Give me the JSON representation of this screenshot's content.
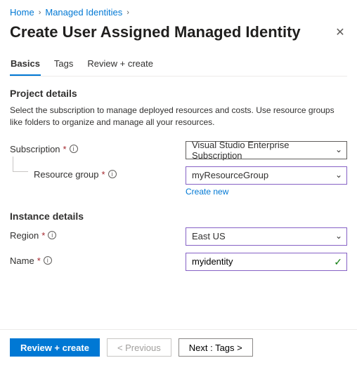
{
  "breadcrumb": {
    "items": [
      "Home",
      "Managed Identities"
    ]
  },
  "title": "Create User Assigned Managed Identity",
  "tabs": {
    "basics": "Basics",
    "tags": "Tags",
    "review": "Review + create"
  },
  "project": {
    "heading": "Project details",
    "description": "Select the subscription to manage deployed resources and costs. Use resource groups like folders to organize and manage all your resources.",
    "subscription_label": "Subscription",
    "subscription_value": "Visual Studio Enterprise Subscription",
    "rg_label": "Resource group",
    "rg_value": "myResourceGroup",
    "create_new": "Create new"
  },
  "instance": {
    "heading": "Instance details",
    "region_label": "Region",
    "region_value": "East US",
    "name_label": "Name",
    "name_value": "myidentity"
  },
  "footer": {
    "review": "Review + create",
    "prev": "< Previous",
    "next": "Next : Tags >"
  }
}
